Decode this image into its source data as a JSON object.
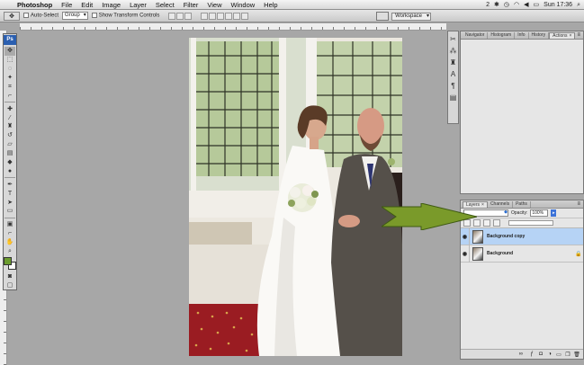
{
  "menubar": {
    "app": "Photoshop",
    "items": [
      "File",
      "Edit",
      "Image",
      "Layer",
      "Select",
      "Filter",
      "View",
      "Window",
      "Help"
    ],
    "status": {
      "badge": "2",
      "clock": "Sun 17:36"
    }
  },
  "options": {
    "auto_select": "Auto-Select",
    "group": "Group",
    "transform": "Show Transform Controls",
    "workspace": "Workspace"
  },
  "tools": {
    "logo": "Ps",
    "foreground_color": "#6b9c2e",
    "background_color": "#ffffff"
  },
  "top_panel": {
    "tabs": [
      "Navigator",
      "Histogram",
      "Info",
      "History",
      "Actions"
    ],
    "active": "Actions"
  },
  "layers_panel": {
    "tabs": [
      "Layers",
      "Channels",
      "Paths"
    ],
    "opacity_label": "Opacity:",
    "opacity_value": "100%",
    "layers": [
      {
        "name": "Background copy",
        "selected": true
      },
      {
        "name": "Background",
        "selected": false
      }
    ]
  },
  "annotation": {
    "arrow_color": "#7a9a2a"
  }
}
